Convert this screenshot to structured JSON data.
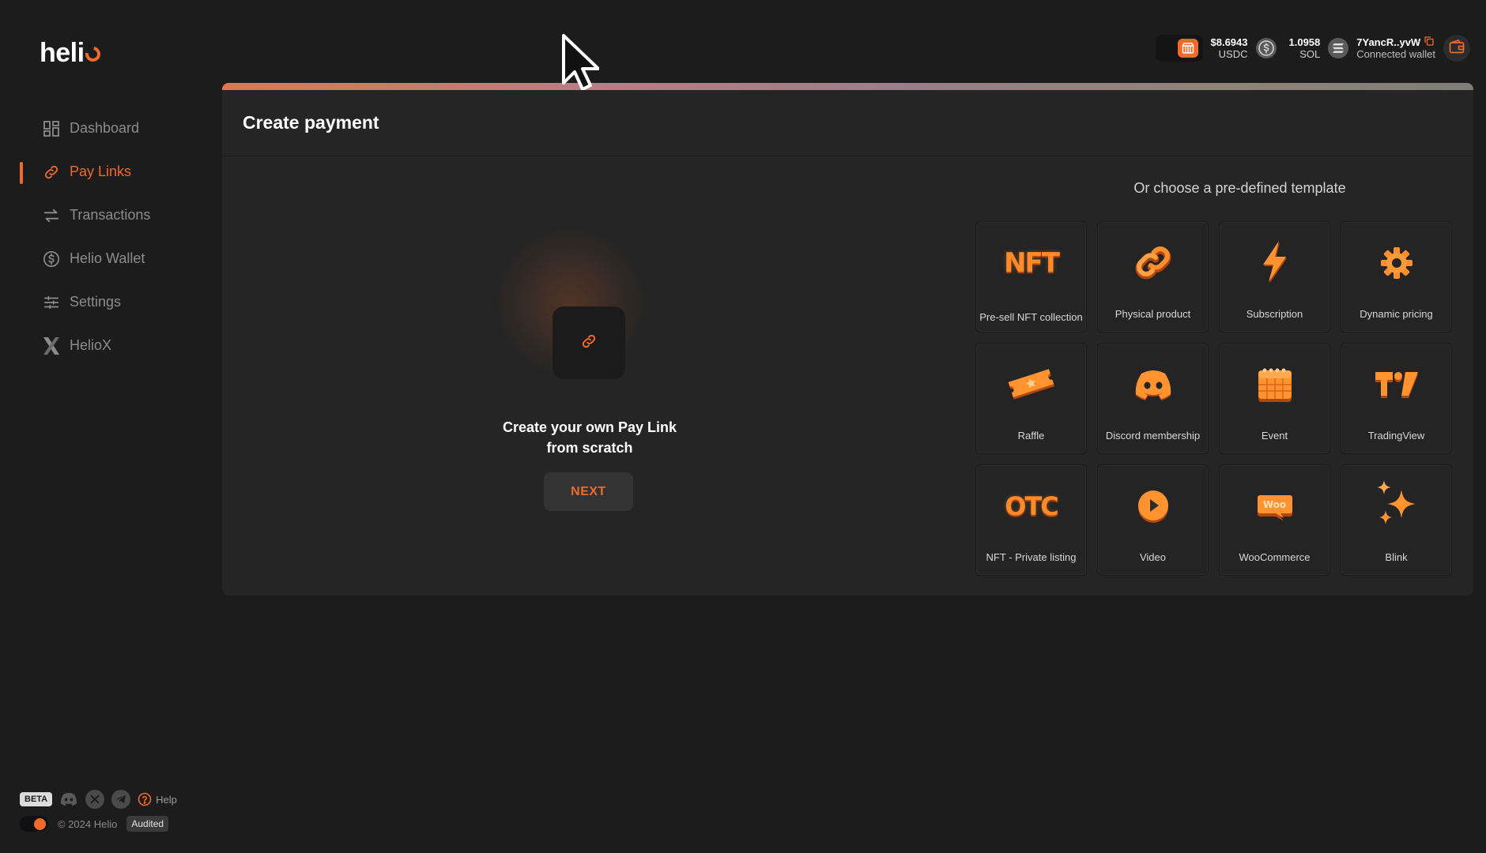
{
  "app": {
    "logo_text": "heli"
  },
  "sidebar": {
    "items": [
      {
        "label": "Dashboard",
        "icon": "dashboard-icon",
        "active": false
      },
      {
        "label": "Pay Links",
        "icon": "link-icon",
        "active": true
      },
      {
        "label": "Transactions",
        "icon": "transfer-arrows-icon",
        "active": false
      },
      {
        "label": "Helio Wallet",
        "icon": "dollar-coin-icon",
        "active": false
      },
      {
        "label": "Settings",
        "icon": "sliders-icon",
        "active": false
      },
      {
        "label": "HelioX",
        "icon": "x-logo-icon",
        "active": false
      }
    ]
  },
  "topbar": {
    "usdc_amount": "$8.6943",
    "usdc_label": "USDC",
    "sol_amount": "1.0958",
    "sol_label": "SOL",
    "wallet_address": "7YancR..yvW",
    "wallet_status": "Connected wallet"
  },
  "main": {
    "title": "Create payment",
    "scratch": {
      "text_line1": "Create your own Pay Link",
      "text_line2": "from scratch",
      "next_label": "NEXT"
    },
    "templates_title": "Or choose a pre-defined template",
    "templates": [
      {
        "label": "Pre-sell NFT collection",
        "icon": "nft-icon"
      },
      {
        "label": "Physical product",
        "icon": "chain-link-icon"
      },
      {
        "label": "Subscription",
        "icon": "lightning-icon"
      },
      {
        "label": "Dynamic pricing",
        "icon": "gear-icon"
      },
      {
        "label": "Raffle",
        "icon": "ticket-icon"
      },
      {
        "label": "Discord membership",
        "icon": "discord-icon"
      },
      {
        "label": "Event",
        "icon": "calendar-icon"
      },
      {
        "label": "TradingView",
        "icon": "tradingview-icon"
      },
      {
        "label": "NFT - Private listing",
        "icon": "otc-icon"
      },
      {
        "label": "Video",
        "icon": "play-icon"
      },
      {
        "label": "WooCommerce",
        "icon": "woocommerce-icon"
      },
      {
        "label": "Blink",
        "icon": "sparkle-icon"
      }
    ],
    "icon_text": {
      "nft": "NFT",
      "otc": "OTC",
      "woo": "Woo",
      "tv": "TV"
    }
  },
  "footer": {
    "beta": "BETA",
    "help": "Help",
    "copyright": "© 2024 Helio",
    "audited": "Audited"
  },
  "colors": {
    "accent": "#ef6a2b",
    "background": "#1c1c1c",
    "panel": "#252525"
  }
}
